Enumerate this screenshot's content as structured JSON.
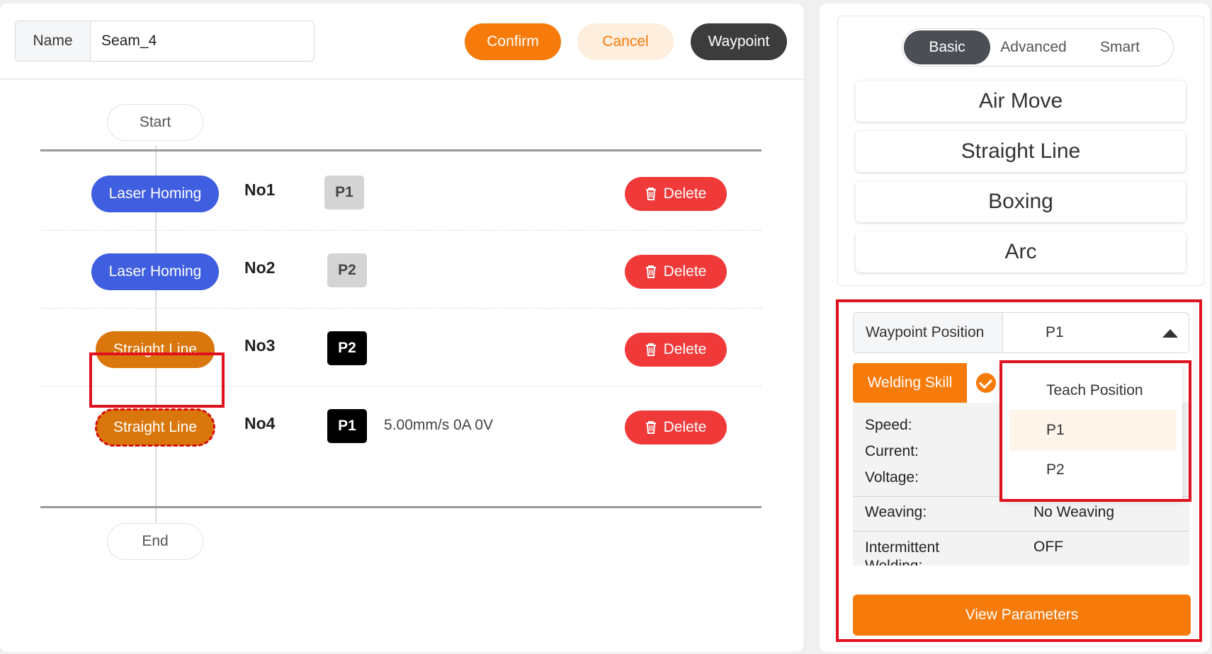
{
  "header": {
    "name_label": "Name",
    "name_value": "Seam_4",
    "confirm_label": "Confirm",
    "cancel_label": "Cancel",
    "waypoint_label": "Waypoint"
  },
  "flow": {
    "start_label": "Start",
    "end_label": "End",
    "delete_label": "Delete",
    "steps": [
      {
        "type": "Laser Homing",
        "no": "No1",
        "point": "P1",
        "params": ""
      },
      {
        "type": "Laser Homing",
        "no": "No2",
        "point": "P2",
        "params": ""
      },
      {
        "type": "Straight Line",
        "no": "No3",
        "point": "P2",
        "params": ""
      },
      {
        "type": "Straight Line",
        "no": "No4",
        "point": "P1",
        "params": "5.00mm/s 0A 0V"
      }
    ]
  },
  "actions": {
    "tabs": [
      "Basic",
      "Advanced",
      "Smart"
    ],
    "active_tab": "Basic",
    "buttons": [
      "Air Move",
      "Straight Line",
      "Boxing",
      "Arc"
    ]
  },
  "config": {
    "waypoint_position_label": "Waypoint Position",
    "waypoint_position_value": "P1",
    "welding_skill_label": "Welding Skill",
    "speed_label": "Speed:",
    "current_label": "Current:",
    "voltage_label": "Voltage:",
    "weaving_label": "Weaving:",
    "weaving_value": "No Weaving",
    "intermittent_label": "Intermittent Welding:",
    "intermittent_value": "OFF",
    "view_parameters_label": "View Parameters",
    "dropdown_options": [
      "Teach Position",
      "P1",
      "P2"
    ],
    "dropdown_selected": "P1"
  },
  "colors": {
    "accent_orange": "#f77b0b",
    "step_blue": "#3f5ee0",
    "step_orange": "#d9760c",
    "delete_red": "#f03a3a",
    "highlight_red": "#e0101e"
  }
}
